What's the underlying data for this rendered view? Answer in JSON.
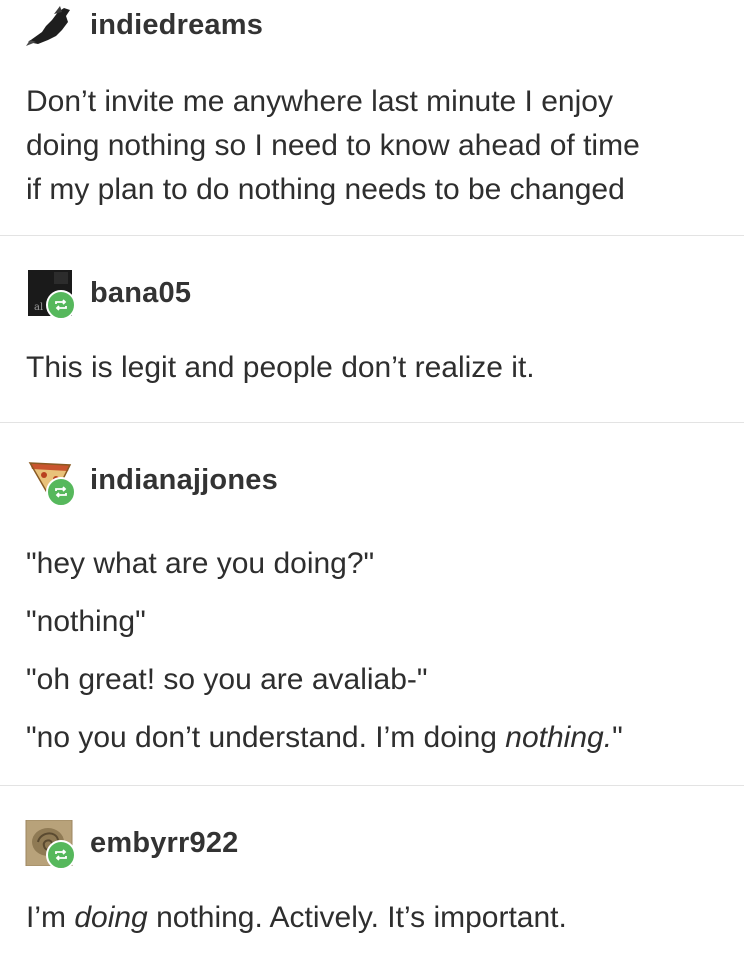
{
  "posts": [
    {
      "username": "indiedreams",
      "avatar_icon": "bird-avatar-icon",
      "reblogged": false,
      "lines": [
        "Don’t invite me anywhere last minute I enjoy",
        "doing nothing so I need to know ahead of time",
        "if my plan to do nothing needs to be changed"
      ]
    },
    {
      "username": "bana05",
      "avatar_icon": "dark-avatar-icon",
      "reblogged": true,
      "lines": [
        "This is legit and people don’t realize it."
      ]
    },
    {
      "username": "indianajjones",
      "avatar_icon": "pizza-avatar-icon",
      "reblogged": true,
      "lines": [
        "\"hey what are you doing?\"",
        "\"nothing\"",
        "\"oh great! so you are avaliab-\""
      ],
      "last_line": {
        "before": "\"no you don’t understand. I’m doing ",
        "emphasis": "nothing.",
        "after": "\""
      }
    },
    {
      "username": "embyrr922",
      "avatar_icon": "fossil-avatar-icon",
      "reblogged": true,
      "text": {
        "before": "I’m ",
        "emphasis": "doing",
        "after": " nothing. Actively. It’s important."
      }
    }
  ],
  "colors": {
    "reblog_badge": "#56b85c",
    "divider": "#e3e3e3",
    "text": "#2e2e2e"
  }
}
